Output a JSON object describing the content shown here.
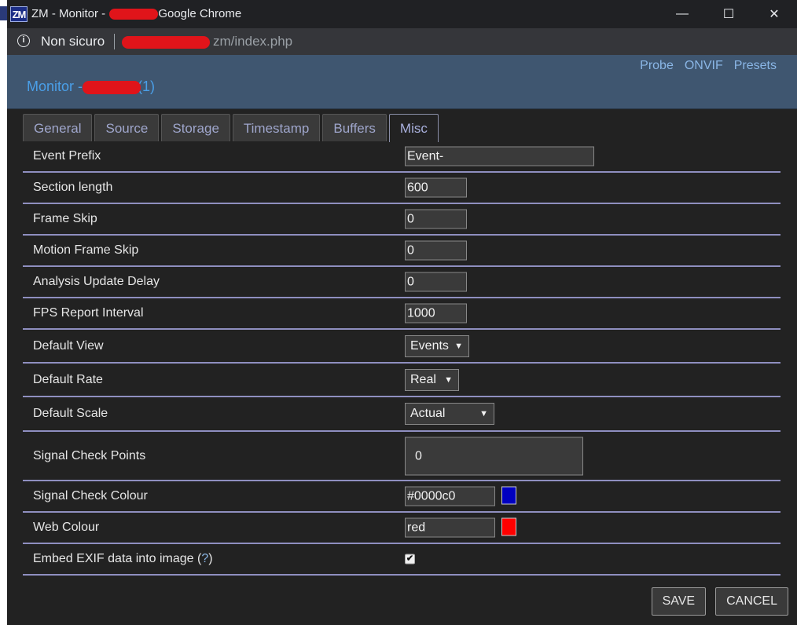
{
  "browser": {
    "window_title_pre": "ZM - Monitor -",
    "window_title_post": "- Google Chrome",
    "app_icon_text": "ZM",
    "security_label": "Non sicuro",
    "url_visible": "zm/index.php",
    "minimize_glyph": "—",
    "maximize_glyph": "☐",
    "close_glyph": "✕",
    "info_glyph": "i"
  },
  "header": {
    "links": [
      "Probe",
      "ONVIF",
      "Presets"
    ],
    "monitor_prefix": "Monitor -",
    "monitor_suffix": "(1)"
  },
  "tabs": [
    {
      "label": "General",
      "active": false
    },
    {
      "label": "Source",
      "active": false
    },
    {
      "label": "Storage",
      "active": false
    },
    {
      "label": "Timestamp",
      "active": false
    },
    {
      "label": "Buffers",
      "active": false
    },
    {
      "label": "Misc",
      "active": true
    }
  ],
  "fields": {
    "event_prefix": {
      "label": "Event Prefix",
      "value": "Event-"
    },
    "section_length": {
      "label": "Section length",
      "value": "600"
    },
    "frame_skip": {
      "label": "Frame Skip",
      "value": "0"
    },
    "motion_frame_skip": {
      "label": "Motion Frame Skip",
      "value": "0"
    },
    "analysis_update_delay": {
      "label": "Analysis Update Delay",
      "value": "0"
    },
    "fps_report_interval": {
      "label": "FPS Report Interval",
      "value": "1000"
    },
    "default_view": {
      "label": "Default View",
      "value": "Events"
    },
    "default_rate": {
      "label": "Default Rate",
      "value": "Real"
    },
    "default_scale": {
      "label": "Default Scale",
      "value": "Actual"
    },
    "signal_check_points": {
      "label": "Signal Check Points",
      "value": "0"
    },
    "signal_check_colour": {
      "label": "Signal Check Colour",
      "value": "#0000c0",
      "swatch": "#0000c0"
    },
    "web_colour": {
      "label": "Web Colour",
      "value": "red",
      "swatch": "#ff0000"
    },
    "embed_exif": {
      "label": "Embed EXIF data into image",
      "help": "?",
      "checked": true,
      "check_glyph": "✔"
    }
  },
  "select_caret": "▼",
  "buttons": {
    "save": "SAVE",
    "cancel": "CANCEL"
  },
  "colors": {
    "header_bg": "#3f5670",
    "link": "#8ab6e6",
    "content_bg": "#222222",
    "row_divider": "#8f8fc0"
  }
}
